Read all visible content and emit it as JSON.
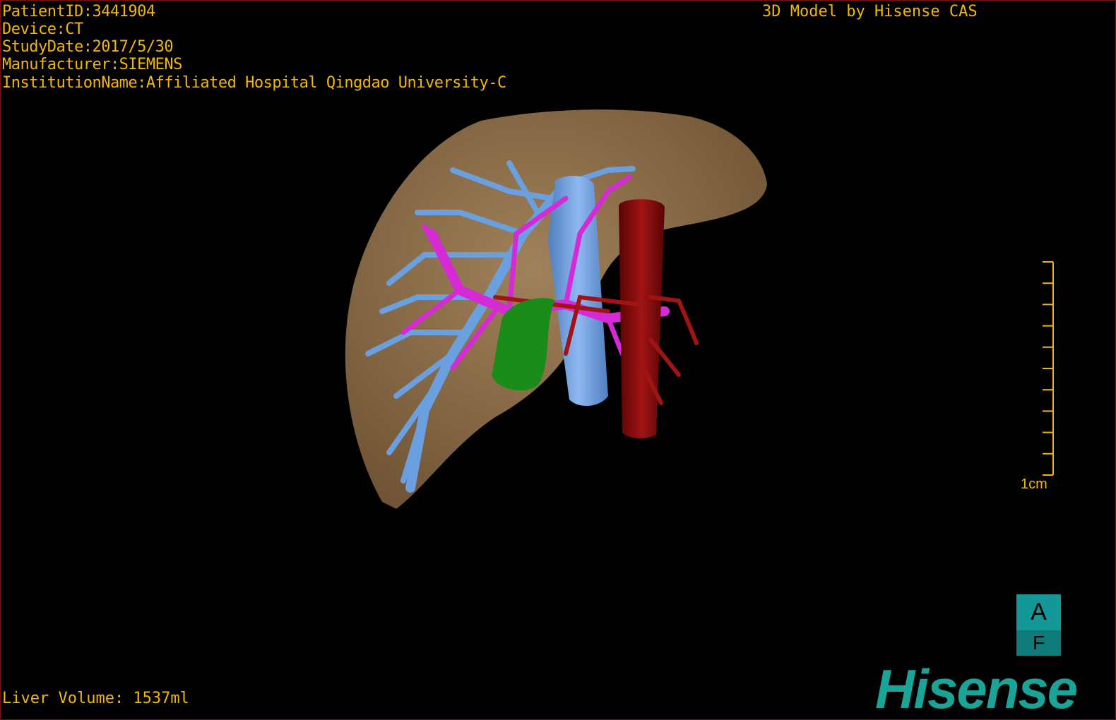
{
  "header": {
    "patient_id": "PatientID:3441904",
    "device": "Device:CT",
    "study_date": "StudyDate:2017/5/30",
    "manufacturer": "Manufacturer:SIEMENS",
    "institution": "InstitutionName:Affiliated Hospital Qingdao University-C"
  },
  "caption": "3D Model by Hisense CAS",
  "liver_volume": "Liver Volume: 1537ml",
  "scale_bar": {
    "label": "1cm",
    "ticks": 11
  },
  "orientation_cube": {
    "top": "A",
    "bottom": "F"
  },
  "logo": "Hisense",
  "colors": {
    "text": "#f2b705",
    "liver": "#8b6b44",
    "hepatic_vein": "#6a9fe0",
    "portal_vein": "#d62ad6",
    "artery": "#8b0a0a",
    "gallbladder": "#1a8c1a",
    "brand": "#19a497"
  }
}
